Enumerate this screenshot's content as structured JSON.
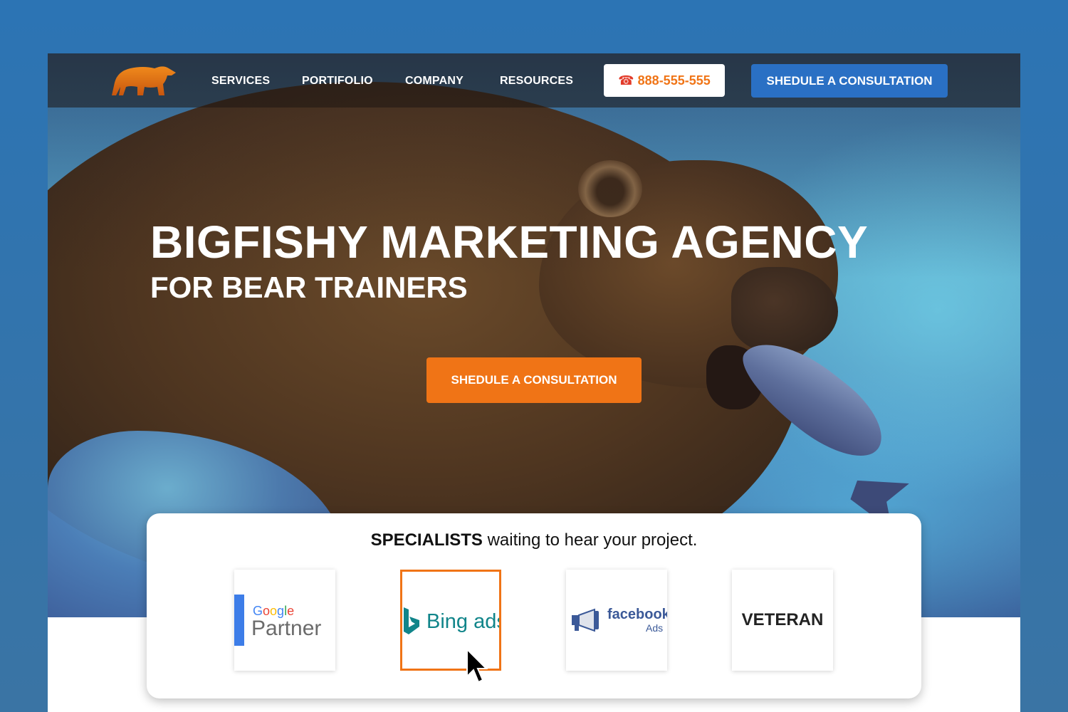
{
  "nav": {
    "items": [
      "SERVICES",
      "PORTIFOLIO",
      "COMPANY",
      "RESOURCES"
    ],
    "phone": "888-555-555",
    "phone_icon": "telephone-icon",
    "cta": "SHEDULE A CONSULTATION"
  },
  "hero": {
    "title": "BIGFISHY MARKETING AGENCY",
    "subtitle": "FOR BEAR TRAINERS",
    "cta": "SHEDULE A CONSULTATION"
  },
  "partners": {
    "heading_strong": "SPECIALISTS",
    "heading_rest": " waiting to hear your project.",
    "badges": [
      {
        "name": "google-partner",
        "line1": "Google",
        "line2": "Partner"
      },
      {
        "name": "bing-ads",
        "text": "Bing ads"
      },
      {
        "name": "facebook-ads",
        "line1": "facebook",
        "line2": "Ads"
      },
      {
        "name": "veteran",
        "text": "VETERAN"
      }
    ],
    "selected_index": 1
  },
  "colors": {
    "accent_orange": "#f07416",
    "accent_blue": "#2a70c4",
    "page_bg": "#2c74b4"
  }
}
